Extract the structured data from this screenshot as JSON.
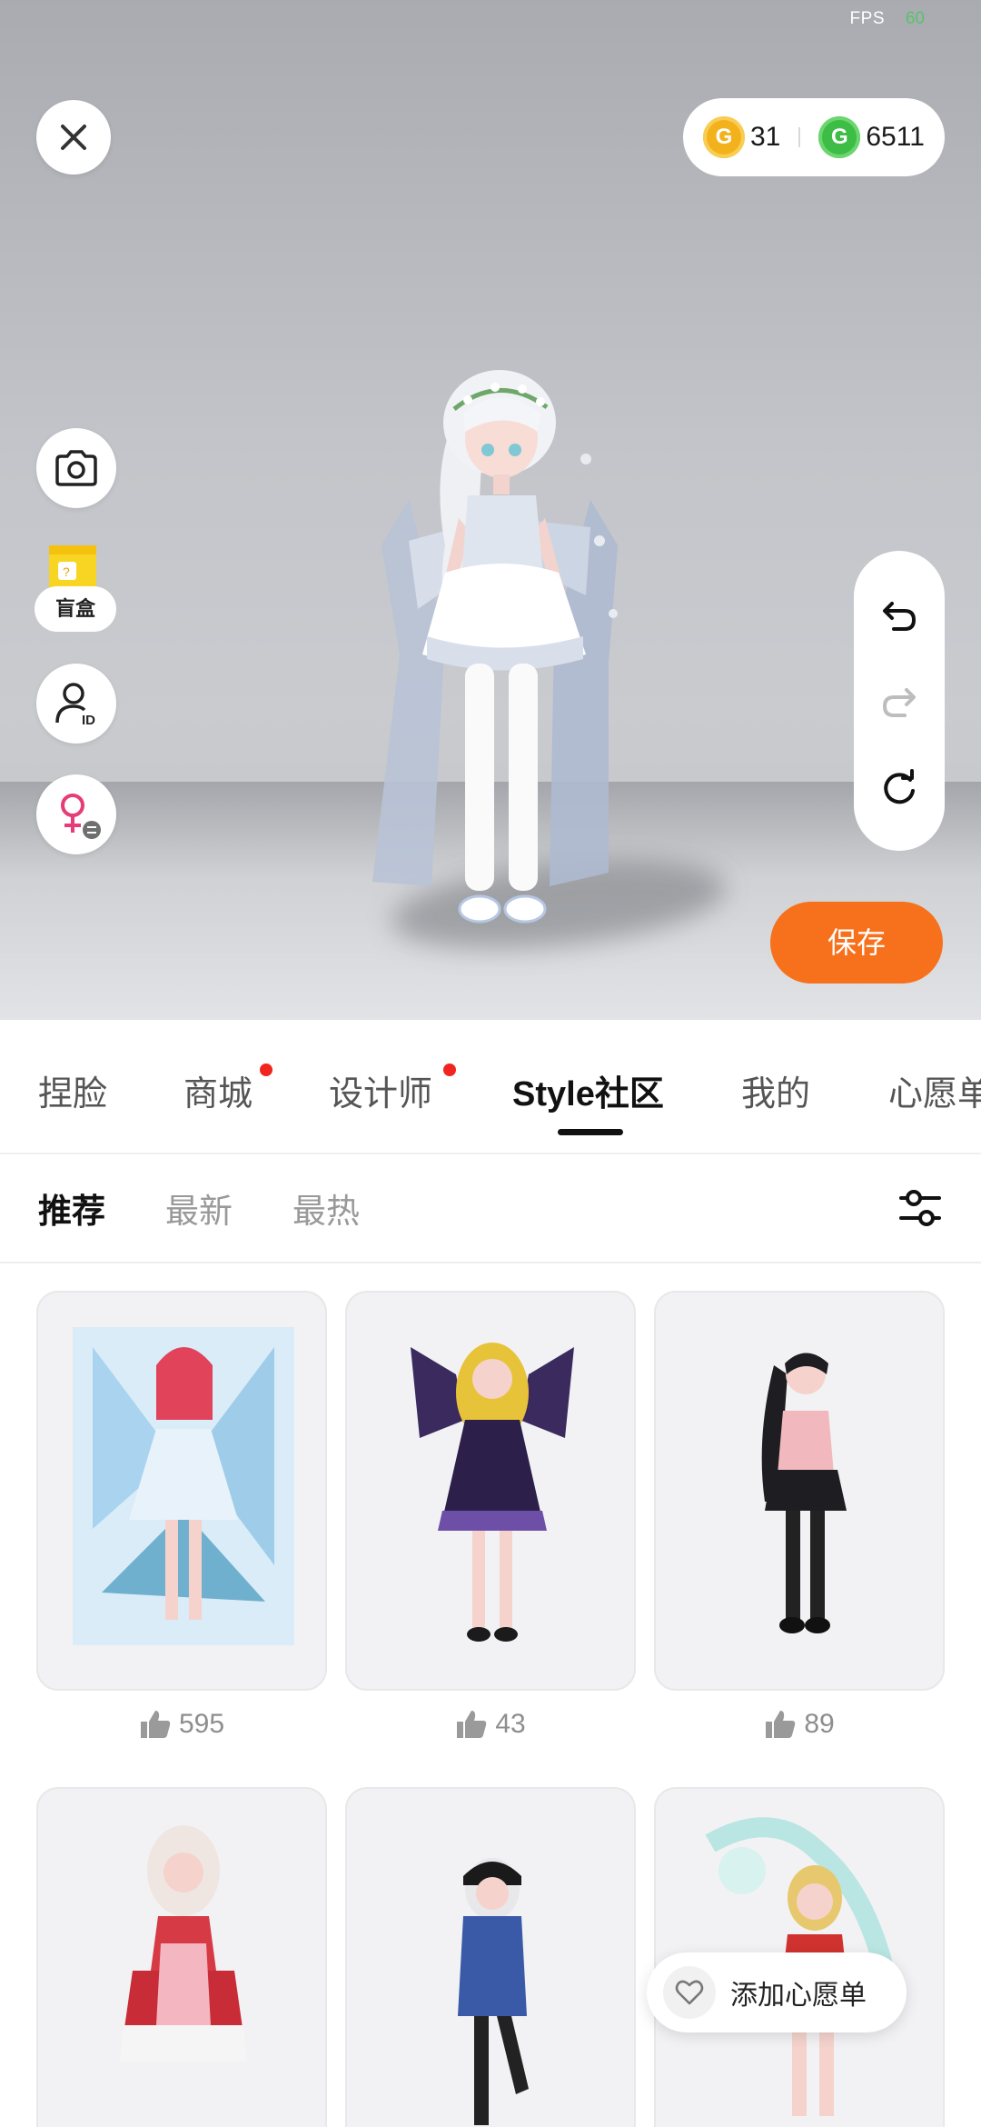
{
  "status": {
    "fps_label": "FPS",
    "fps_value": "60"
  },
  "currency": {
    "gold": {
      "icon": "gold-coin-icon",
      "symbol": "G",
      "value": "31",
      "color": "#f3b21c"
    },
    "green": {
      "icon": "green-gem-icon",
      "symbol": "G",
      "value": "6511",
      "color": "#3dbd45"
    }
  },
  "side_tools": {
    "close": "close-icon",
    "camera": "camera-icon",
    "blind_box_label": "盲盒",
    "avatar_id": "avatar-id-icon",
    "gender_swap": "gender-swap-icon"
  },
  "history_controls": {
    "undo": "undo-icon",
    "redo": "redo-icon",
    "reset": "reset-icon"
  },
  "save_button": "保存",
  "main_tabs": [
    {
      "label": "捏脸",
      "dot": false
    },
    {
      "label": "商城",
      "dot": true
    },
    {
      "label": "设计师",
      "dot": true
    },
    {
      "label": "Style社区",
      "dot": false,
      "active": true
    },
    {
      "label": "我的",
      "dot": false
    },
    {
      "label": "心愿单",
      "dot": false
    }
  ],
  "sub_tabs": [
    {
      "label": "推荐",
      "active": true
    },
    {
      "label": "最新"
    },
    {
      "label": "最热"
    }
  ],
  "filter_icon": "filter-sliders-icon",
  "grid": {
    "cards": [
      {
        "likes": "595",
        "theme": "ice-wings"
      },
      {
        "likes": "43",
        "theme": "butterfly-gothic"
      },
      {
        "likes": "89",
        "theme": "pink-black-dress"
      },
      {
        "likes": "",
        "theme": "red-apron-dress"
      },
      {
        "likes": "",
        "theme": "blue-hoodie"
      },
      {
        "likes": "",
        "theme": "dragon-red"
      }
    ]
  },
  "wishlist_button": {
    "label": "添加心愿单",
    "icon": "heart-icon"
  },
  "colors": {
    "accent": "#f7711c",
    "red_dot": "#f2241f",
    "active_text": "#111111"
  }
}
